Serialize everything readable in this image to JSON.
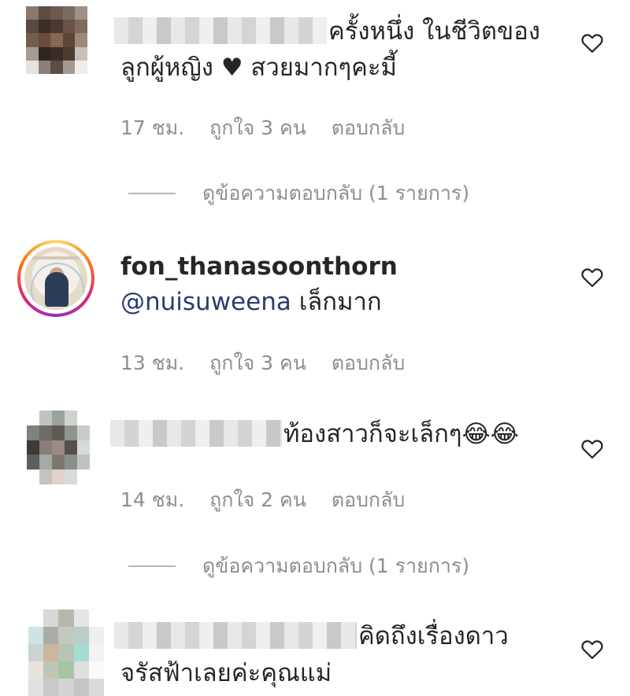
{
  "comments": [
    {
      "text_line1": "ครั้งหนึ่ง ในชีวิตของ",
      "text_line2": "ลูกผู้หญิง ♥ สวยมากๆคะมี้",
      "time": "17 ชม.",
      "likes": "ถูกใจ 3 คน",
      "reply": "ตอบกลับ",
      "view_replies": "ดูข้อความตอบกลับ (1 รายการ)"
    },
    {
      "username": "fon_thanasoonthorn",
      "mention": "@nuisuweena",
      "text": " เล็กมาก",
      "time": "13 ชม.",
      "likes": "ถูกใจ 3 คน",
      "reply": "ตอบกลับ"
    },
    {
      "text_line1": "ท้องสาวก็จะเล็กๆ😂😂",
      "time": "14 ชม.",
      "likes": "ถูกใจ 2 คน",
      "reply": "ตอบกลับ",
      "view_replies": "ดูข้อความตอบกลับ (1 รายการ)"
    },
    {
      "text_line1": "คิดถึงเรื่องดาว",
      "text_line2": "จรัสฟ้าเลยค่ะคุณแม่"
    }
  ],
  "icons": {
    "like": "heart-outline-icon"
  },
  "colors": {
    "meta_text": "#8e8e8e",
    "mention": "#2a3d6e",
    "text": "#262626"
  }
}
